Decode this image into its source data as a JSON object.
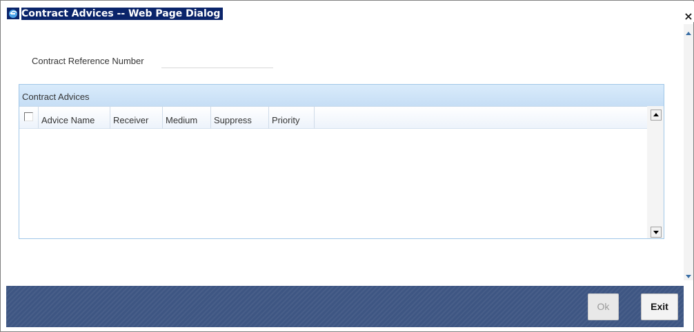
{
  "window": {
    "title": "Contract Advices -- Web Page Dialog",
    "close_glyph": "×"
  },
  "form": {
    "reference_label": "Contract Reference Number",
    "reference_value": ""
  },
  "advices": {
    "section_title": "Contract Advices",
    "columns": [
      "Advice Name",
      "Receiver",
      "Medium",
      "Suppress",
      "Priority"
    ],
    "rows": []
  },
  "footer": {
    "ok_label": "Ok",
    "exit_label": "Exit"
  },
  "icons": {
    "title": "ie-dialog-icon",
    "close": "close-icon",
    "scroll_up": "scroll-up-arrow-icon",
    "scroll_down": "scroll-down-arrow-icon"
  },
  "colors": {
    "title_highlight": "#0a246a",
    "panel_header": "#c6def5",
    "panel_border": "#9fc6e8",
    "footer_band": "#3e5683"
  }
}
